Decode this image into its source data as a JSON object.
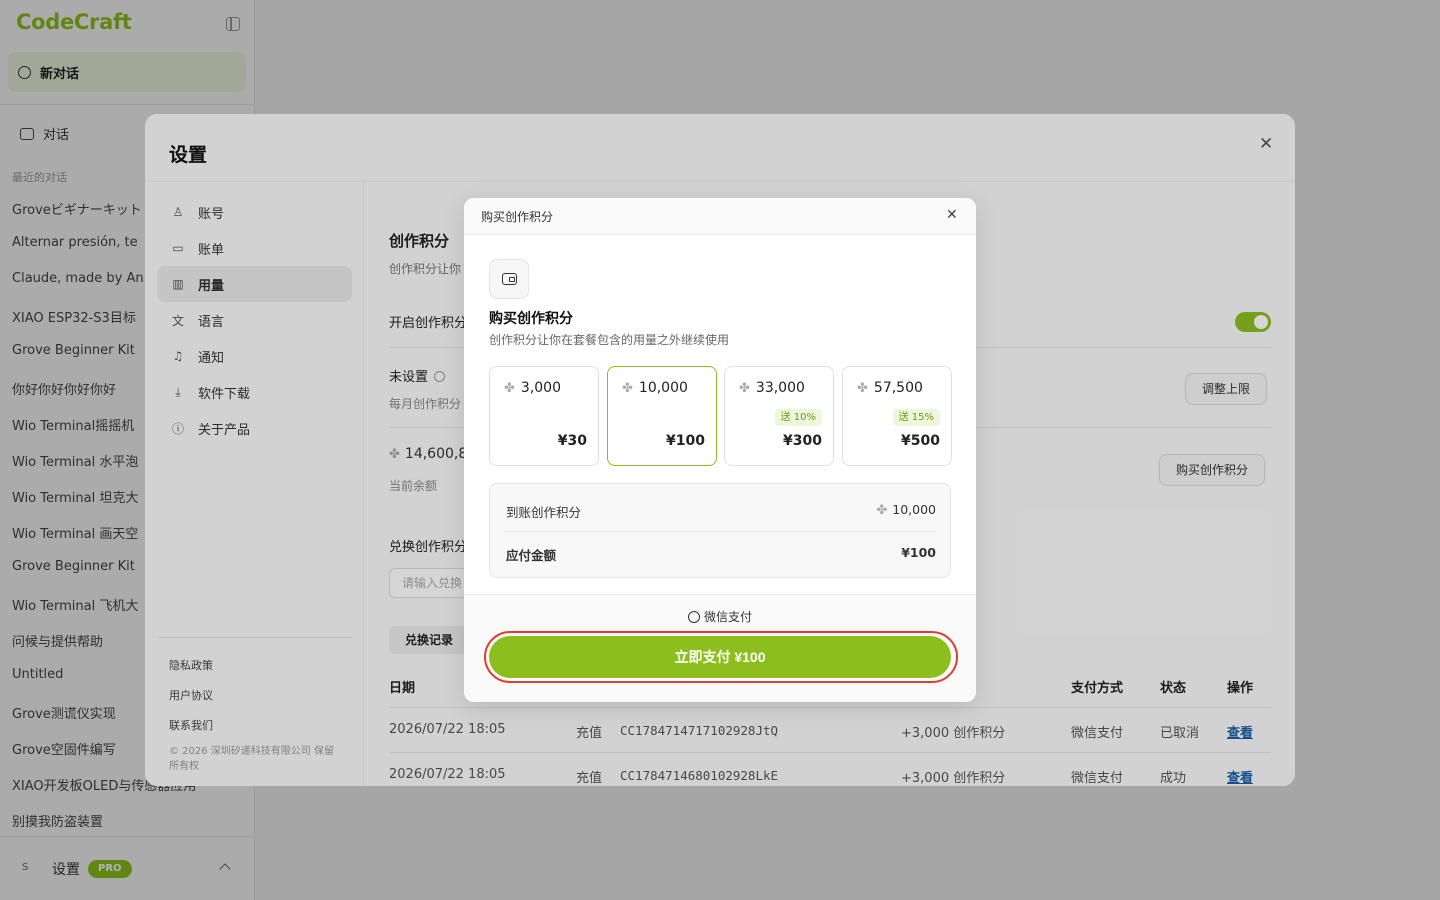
{
  "app": {
    "logo": "CodeCraft",
    "new_chat": "新对话",
    "nav_chat": "对话",
    "recent_title": "最近的对话",
    "recent": [
      "Groveビギナーキット",
      "Alternar presión, te",
      "Claude, made by An",
      "XIAO ESP32-S3目标",
      "Grove Beginner Kit",
      "你好你好你好你好",
      "Wio Terminal摇摇机",
      "Wio Terminal 水平泡",
      "Wio Terminal 坦克大",
      "Wio Terminal 画天空",
      "Grove Beginner Kit",
      "Wio Terminal 飞机大",
      "问候与提供帮助",
      "Untitled",
      "Grove测谎仪实现",
      "Grove空固件编写",
      "XIAO开发板OLED与传感器应用",
      "别摸我防盗装置"
    ],
    "account": {
      "avatar": "S",
      "name": "设置",
      "badge": "PRO"
    }
  },
  "settings": {
    "title": "设置",
    "nav": [
      {
        "label": "账号",
        "icon": "user-icon"
      },
      {
        "label": "账单",
        "icon": "card-icon"
      },
      {
        "label": "用量",
        "icon": "chart-icon",
        "active": true
      },
      {
        "label": "语言",
        "icon": "translate-icon"
      },
      {
        "label": "通知",
        "icon": "bell-icon"
      },
      {
        "label": "软件下载",
        "icon": "download-icon"
      },
      {
        "label": "关于产品",
        "icon": "info-icon"
      }
    ],
    "footer": {
      "privacy": "隐私政策",
      "terms": "用户协议",
      "contact": "联系我们",
      "copyright": "© 2026 深圳矽递科技有限公司 保留所有权"
    },
    "main": {
      "heading": "创作积分",
      "subheading": "创作积分让你",
      "enable_label": "开启创作积分",
      "limit_label": "未设置",
      "limit_sub": "每月创作积分",
      "adjust_btn": "调整上限",
      "balance": "14,600,8",
      "balance_sub": "当前余额",
      "buy_btn": "购买创作积分",
      "redeem_label": "兑换创作积分",
      "redeem_placeholder": "请输入兑换",
      "tab": "兑换记录",
      "table": {
        "headers": {
          "date": "日期",
          "method": "支付方式",
          "status": "状态",
          "action": "操作"
        },
        "rows": [
          {
            "date": "2026/07/22 18:05",
            "type": "充值",
            "order": "CC1784714717102928JtQ",
            "amount": "+3,000 创作积分",
            "method": "微信支付",
            "status": "已取消",
            "action": "查看"
          },
          {
            "date": "2026/07/22 18:05",
            "type": "充值",
            "order": "CC1784714680102928LkE",
            "amount": "+3,000 创作积分",
            "method": "微信支付",
            "status": "成功",
            "action": "查看"
          }
        ]
      }
    }
  },
  "dialog": {
    "title": "购买创作积分",
    "heading": "购买创作积分",
    "subheading": "创作积分让你在套餐包含的用量之外继续使用",
    "packages": [
      {
        "credits": "3,000",
        "price": "¥30",
        "bonus": ""
      },
      {
        "credits": "10,000",
        "price": "¥100",
        "bonus": "",
        "selected": true
      },
      {
        "credits": "33,000",
        "price": "¥300",
        "bonus": "送 10%"
      },
      {
        "credits": "57,500",
        "price": "¥500",
        "bonus": "送 15%"
      }
    ],
    "summary": {
      "credits_label": "到账创作积分",
      "credits_value": "10,000",
      "amount_label": "应付金额",
      "amount_value": "¥100"
    },
    "payment_method": "微信支付",
    "pay_button": "立即支付 ¥100"
  },
  "colors": {
    "accent": "#8cbf1e",
    "highlight_ring": "#e43a2f",
    "link": "#1a5fa8"
  }
}
